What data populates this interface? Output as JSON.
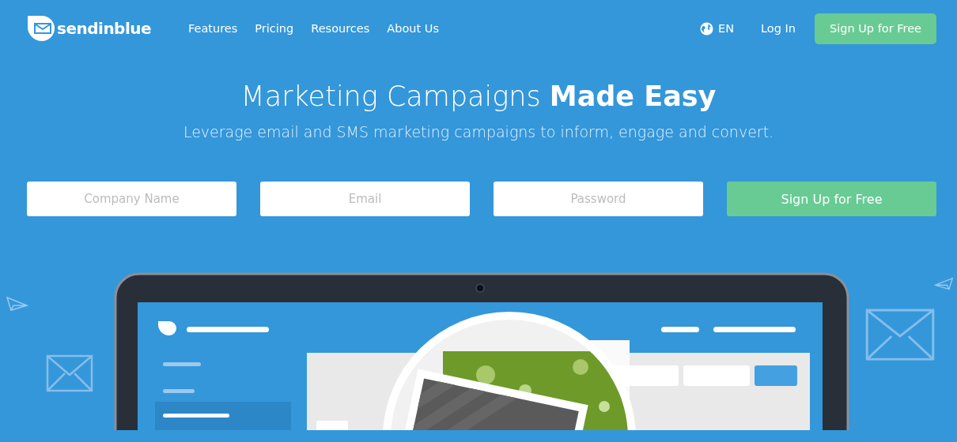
{
  "header": {
    "brand": "sendinblue",
    "nav": [
      {
        "label": "Features"
      },
      {
        "label": "Pricing"
      },
      {
        "label": "Resources"
      },
      {
        "label": "About Us"
      }
    ],
    "language": "EN",
    "login": "Log In",
    "signup": "Sign Up for Free"
  },
  "hero": {
    "title": "Marketing Campaigns **Made Easy**",
    "subtitle": "Leverage email and SMS marketing campaigns to inform, engage and convert."
  },
  "form": {
    "fields": [
      {
        "placeholder": "Company Name"
      },
      {
        "placeholder": "Email"
      },
      {
        "placeholder": "Password"
      }
    ],
    "submit": "Sign Up for Free"
  }
}
